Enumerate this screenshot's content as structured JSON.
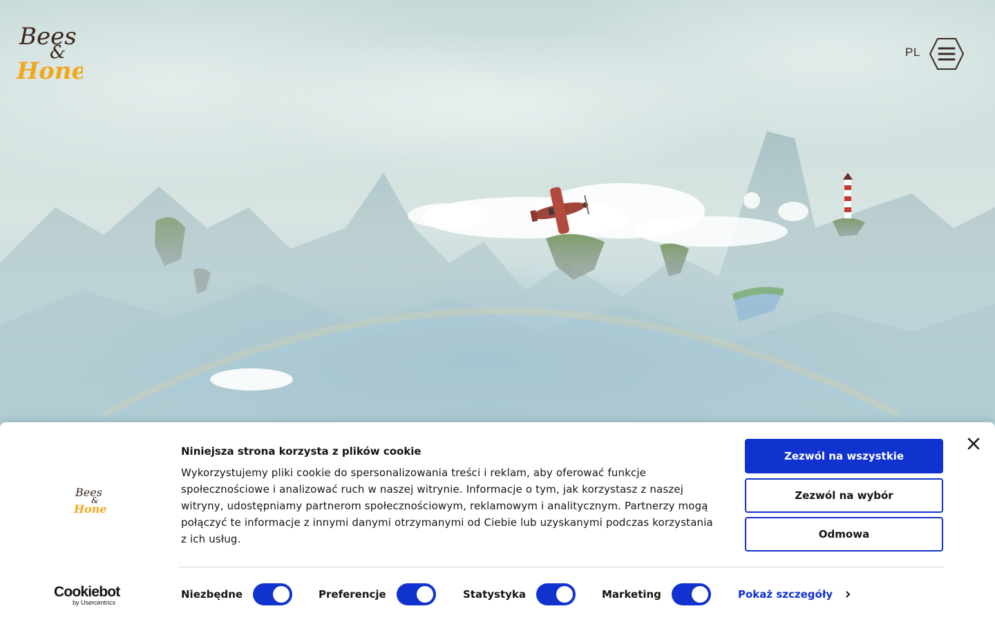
{
  "header": {
    "logo_text_top": "Bees",
    "logo_amp": "&",
    "logo_text_bottom": "Honey",
    "language": "PL",
    "menu_icon": "hamburger-hexagon-icon"
  },
  "cookie_banner": {
    "title": "Niniejsza strona korzysta z plików cookie",
    "body": "Wykorzystujemy pliki cookie do spersonalizowania treści i reklam, aby oferować funkcje społecznościowe i analizować ruch w naszej witrynie. Informacje o tym, jak korzystasz z naszej witryny, udostępniamy partnerom społecznościowym, reklamowym i analitycznym. Partnerzy mogą połączyć te informacje z innymi danymi otrzymanymi od Ciebie lub uzyskanymi podczas korzystania z ich usług.",
    "buttons": {
      "allow_all": "Zezwól na wszystkie",
      "allow_selection": "Zezwól na wybór",
      "deny": "Odmowa"
    },
    "toggles": [
      {
        "label": "Niezbędne",
        "on": true
      },
      {
        "label": "Preferencje",
        "on": true
      },
      {
        "label": "Statystyka",
        "on": true
      },
      {
        "label": "Marketing",
        "on": true
      }
    ],
    "details_link": "Pokaż szczegóły",
    "powered_by": {
      "name": "Cookiebot",
      "sub": "by Usercentrics"
    },
    "accent_color": "#1032cf"
  }
}
